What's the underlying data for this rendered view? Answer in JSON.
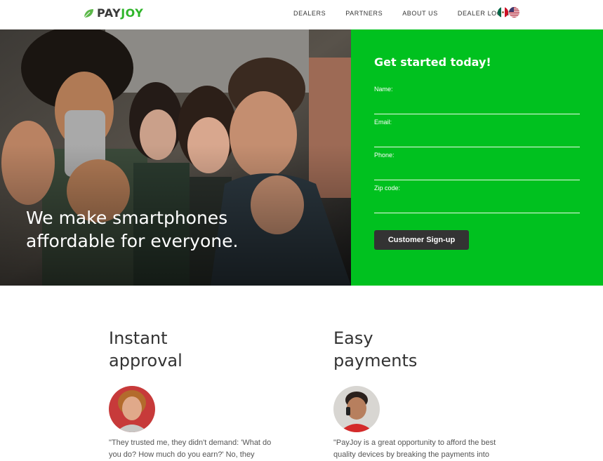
{
  "header": {
    "logo": {
      "part1": "PAY",
      "part2": "JOY"
    },
    "nav": [
      "DEALERS",
      "PARTNERS",
      "ABOUT US",
      "DEALER LOGIN"
    ],
    "flags": [
      "mexico-flag-icon",
      "us-flag-icon"
    ]
  },
  "hero": {
    "headline_line1": "We make smartphones",
    "headline_line2": "affordable for everyone."
  },
  "signup": {
    "title": "Get started today!",
    "fields": [
      {
        "label": "Name:",
        "value": ""
      },
      {
        "label": "Email:",
        "value": ""
      },
      {
        "label": "Phone:",
        "value": ""
      },
      {
        "label": "Zip code:",
        "value": ""
      }
    ],
    "submit_label": "Customer Sign-up"
  },
  "features": [
    {
      "title": "Instant\napproval",
      "quote": "\"They trusted me, they didn't demand: 'What do you do? How much do you earn?' No, they"
    },
    {
      "title": "Easy\npayments",
      "quote": "\"PayJoy is a great opportunity to afford the best quality devices by breaking the payments into"
    }
  ],
  "colors": {
    "brand_green": "#00c11f",
    "logo_green": "#2fb52a",
    "button_dark": "#333333"
  }
}
